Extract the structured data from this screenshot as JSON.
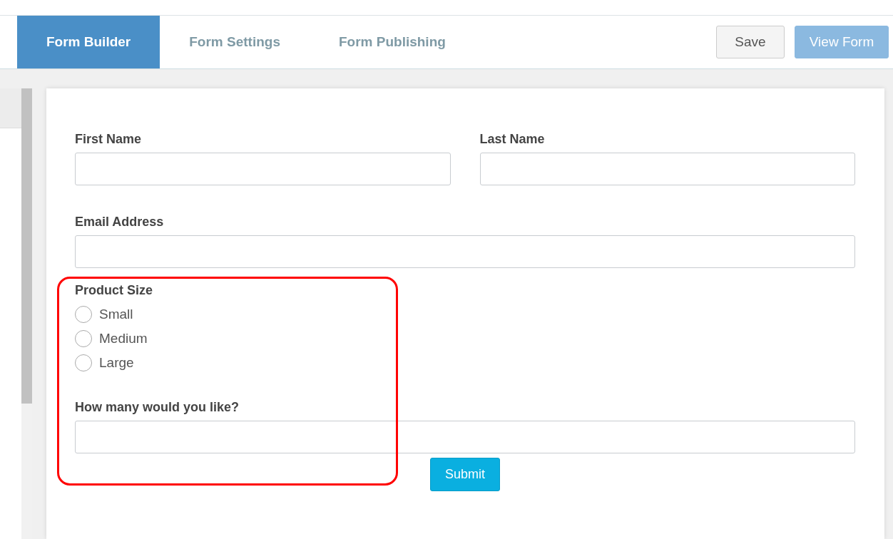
{
  "tabs": [
    {
      "label": "Form Builder",
      "selected": true
    },
    {
      "label": "Form Settings",
      "selected": false
    },
    {
      "label": "Form Publishing",
      "selected": false
    }
  ],
  "actions": [
    {
      "label": "Save",
      "kind": "secondary"
    },
    {
      "label": "View Form",
      "kind": "primary"
    }
  ],
  "form": {
    "rows": [
      {
        "kind": "pair",
        "fields": [
          {
            "label": "First Name"
          },
          {
            "label": "Last Name"
          }
        ]
      },
      {
        "kind": "text",
        "label": "Email Address"
      },
      {
        "kind": "radio",
        "label": "Product Size",
        "options": [
          {
            "label": "Small",
            "selected": false
          },
          {
            "label": "Medium",
            "selected": false
          },
          {
            "label": "Large",
            "selected": false
          }
        ]
      },
      {
        "kind": "text",
        "label": "How many would you like?"
      }
    ],
    "highlighted": true,
    "submit": "Submit"
  }
}
